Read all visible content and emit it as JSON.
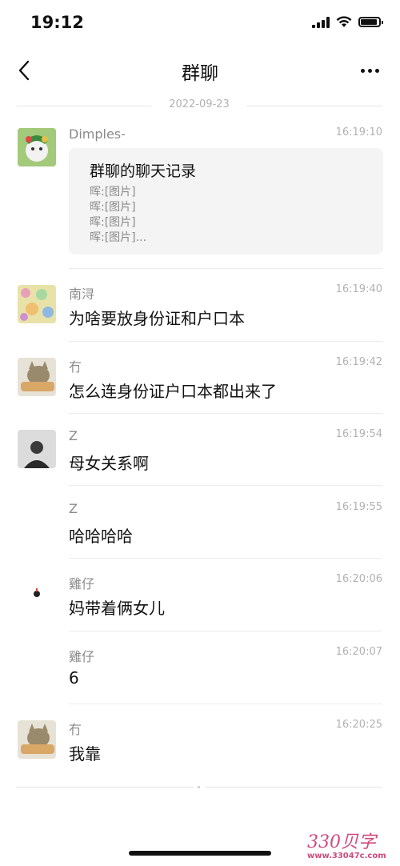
{
  "status_bar": {
    "time": "19:12"
  },
  "nav": {
    "title": "群聊"
  },
  "date_separator": "2022-09-23",
  "messages": [
    {
      "sender": "Dimples-",
      "time": "16:19:10",
      "card": {
        "title": "群聊的聊天记录",
        "lines": [
          "晖:[图片]",
          "晖:[图片]",
          "晖:[图片]",
          "晖:[图片]..."
        ]
      }
    },
    {
      "sender": "南浔",
      "time": "16:19:40",
      "text": "为啥要放身份证和户口本"
    },
    {
      "sender": "冇",
      "time": "16:19:42",
      "text": "怎么连身份证户口本都出来了"
    },
    {
      "sender": "Z",
      "time": "16:19:54",
      "text": "母女关系啊"
    },
    {
      "sender": "Z",
      "time": "16:19:55",
      "text": "哈哈哈哈"
    },
    {
      "sender": "雞仔",
      "time": "16:20:06",
      "text": "妈带着俩女儿"
    },
    {
      "sender": "雞仔",
      "time": "16:20:07",
      "text": "6"
    },
    {
      "sender": "冇",
      "time": "16:20:25",
      "text": "我靠"
    }
  ],
  "watermark": {
    "logo": "330贝字",
    "url": "www.33047c.com"
  },
  "colors": {
    "text": "#111111",
    "secondary": "#8a8a8a",
    "timestamp": "#b2b2b2",
    "card_bg": "#f4f4f4",
    "watermark": "#d04a7c"
  }
}
